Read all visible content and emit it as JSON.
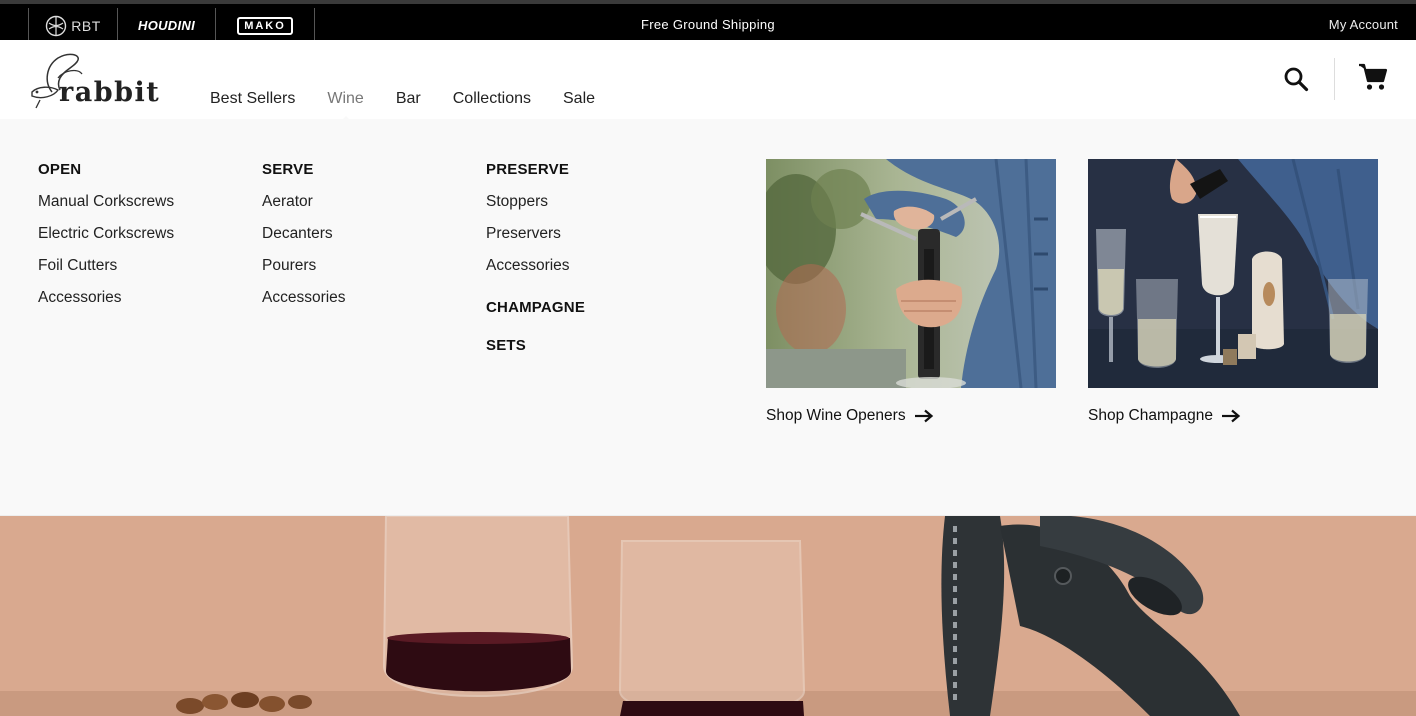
{
  "topbar": {
    "brands": [
      {
        "label": "RBT",
        "icon": "rbt-logo-icon"
      },
      {
        "label": "HOUDINI"
      },
      {
        "label": "MAKO"
      }
    ],
    "promo": "Free Ground Shipping",
    "account": "My Account"
  },
  "header": {
    "logo_text": "rabbit",
    "nav": [
      {
        "label": "Best Sellers"
      },
      {
        "label": "Wine",
        "active": true
      },
      {
        "label": "Bar"
      },
      {
        "label": "Collections"
      },
      {
        "label": "Sale"
      }
    ],
    "icons": [
      "search-icon",
      "cart-icon"
    ]
  },
  "mega": {
    "open": {
      "heading": "OPEN",
      "items": [
        "Manual Corkscrews",
        "Electric Corkscrews",
        "Foil Cutters",
        "Accessories"
      ]
    },
    "serve": {
      "heading": "SERVE",
      "items": [
        "Aerator",
        "Decanters",
        "Pourers",
        "Accessories"
      ]
    },
    "preserve": {
      "heading": "PRESERVE",
      "items": [
        "Stoppers",
        "Preservers",
        "Accessories"
      ]
    },
    "champagne": "CHAMPAGNE",
    "sets": "SETS",
    "cards": [
      {
        "link": "Shop Wine Openers",
        "icon": "arrow-right-icon"
      },
      {
        "link": "Shop Champagne",
        "icon": "arrow-right-icon"
      }
    ]
  },
  "colors": {
    "topbar_bg": "#000000",
    "menu_bg": "#f9f9f9",
    "hero_bg": "#d9a98f"
  }
}
